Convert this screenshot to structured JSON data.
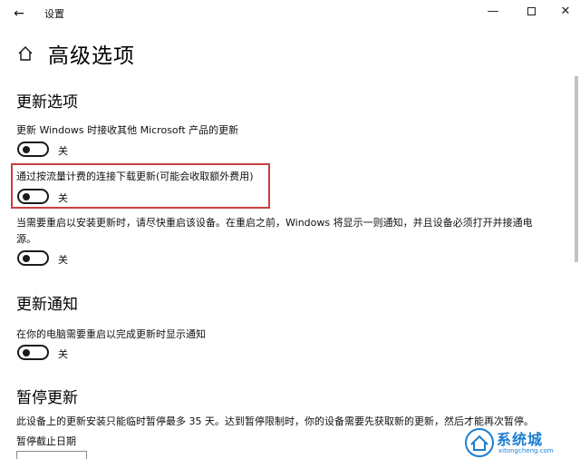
{
  "window": {
    "title": "设置",
    "back_glyph": "←",
    "minimize_glyph": "—",
    "close_glyph": "✕"
  },
  "page": {
    "title": "高级选项"
  },
  "update_options": {
    "heading": "更新选项",
    "items": [
      {
        "description": "更新 Windows 时接收其他 Microsoft 产品的更新",
        "state": "关",
        "on": false
      },
      {
        "description": "通过按流量计费的连接下载更新(可能会收取额外费用)",
        "state": "关",
        "on": false,
        "highlighted": true
      },
      {
        "description": "当需要重启以安装更新时，请尽快重启该设备。在重启之前，Windows 将显示一则通知，并且设备必须打开并接通电源。",
        "state": "关",
        "on": false
      }
    ]
  },
  "update_notifications": {
    "heading": "更新通知",
    "items": [
      {
        "description": "在你的电脑需要重启以完成更新时显示通知",
        "state": "关",
        "on": false
      }
    ]
  },
  "pause_updates": {
    "heading": "暂停更新",
    "description": "此设备上的更新安装只能临时暂停最多 35 天。达到暂停限制时，你的设备需要先获取新的更新，然后才能再次暂停。",
    "date_label": "暂停截止日期"
  },
  "watermark": {
    "text": "系统城",
    "sub": "xitongcheng.com"
  },
  "colors": {
    "highlight_border": "#c6403f",
    "watermark_blue": "#1c7fd1",
    "toggle_off": "#1a1a1a"
  }
}
